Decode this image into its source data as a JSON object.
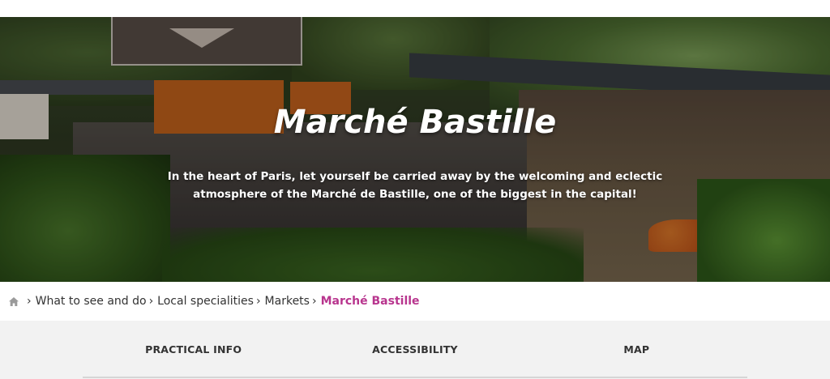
{
  "hero": {
    "title": "Marché Bastille",
    "subtitle": "In the heart of Paris, let yourself be carried away by the welcoming and eclectic atmosphere of the Marché de Bastille, one of the biggest in the capital!",
    "image_icon": "market-stalls-photo"
  },
  "breadcrumb": {
    "home_icon": "home-icon",
    "items": [
      {
        "label": "What to see and do"
      },
      {
        "label": "Local specialities"
      },
      {
        "label": "Markets"
      }
    ],
    "current": "Marché Bastille",
    "current_color": "#b8358e"
  },
  "tabs": [
    {
      "label": "PRACTICAL INFO"
    },
    {
      "label": "ACCESSIBILITY"
    },
    {
      "label": "MAP"
    }
  ]
}
